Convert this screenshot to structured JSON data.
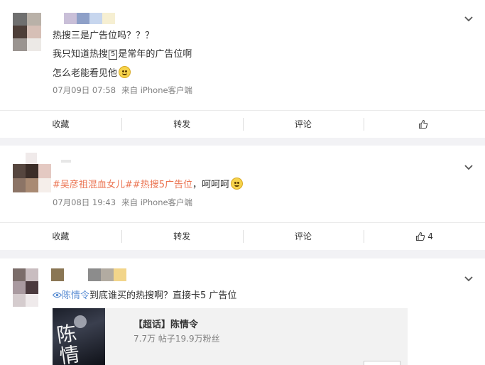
{
  "posts": [
    {
      "lines": [
        "热搜三是广告位吗？？？",
        "我只知道热搜",
        "是常年的广告位啊",
        "怎么老能看见他"
      ],
      "boxed_number": "5",
      "date": "07月09日 07:58",
      "source": "来自 iPhone客户端",
      "actions": {
        "favorite": "收藏",
        "repost": "转发",
        "comment": "评论",
        "like_count": ""
      }
    },
    {
      "hashtag1": "#吴彦祖混血女儿#",
      "hashtag2": "#热搜5广告位",
      "tail": "，呵呵呵",
      "date": "07月08日 19:43",
      "source": "来自 iPhone客户端",
      "actions": {
        "favorite": "收藏",
        "repost": "转发",
        "comment": "评论",
        "like_count": "4"
      }
    },
    {
      "mention": "陈情令",
      "text": "到底谁买的热搜啊？直接卡5 广告位",
      "card_title": "【超话】陈情令",
      "card_stats": "7.7万 帖子19.9万粉丝"
    }
  ],
  "icons": {
    "chevron": "chevron-down-icon",
    "like": "thumbs-up-icon",
    "emoji": "smile-emoji-icon",
    "topic": "supertopic-icon"
  },
  "colors": {
    "link": "#eb7350",
    "mention": "#5b8ed3",
    "background": "#f2f2f5"
  }
}
